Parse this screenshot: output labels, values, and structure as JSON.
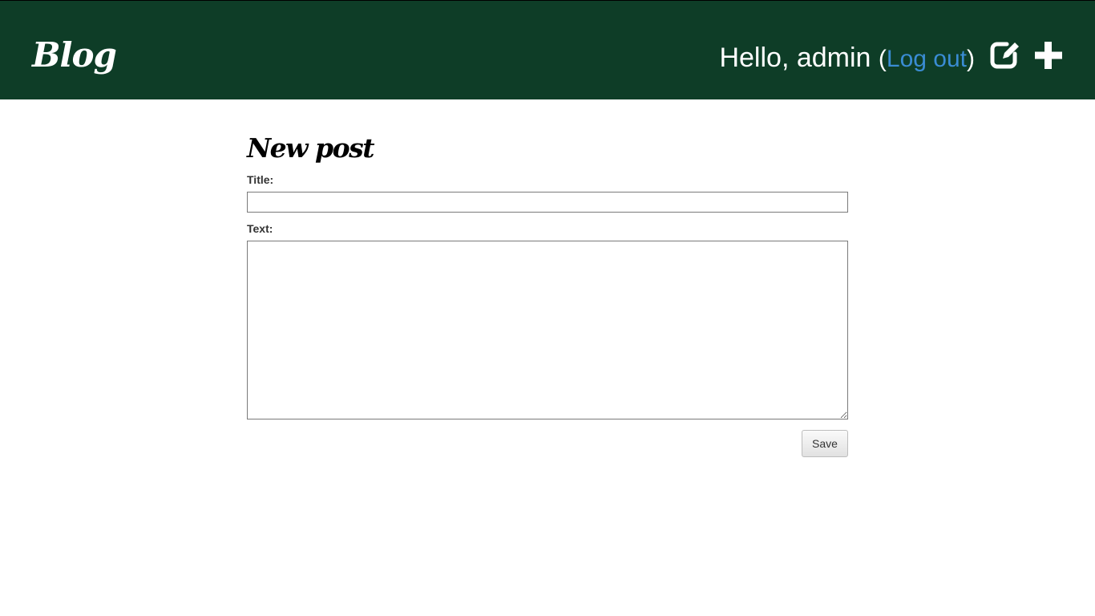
{
  "header": {
    "logo": "Blog",
    "greeting": "Hello, admin",
    "open_paren": "(",
    "logout_label": "Log out",
    "close_paren": ")",
    "icons": [
      "edit-icon",
      "plus-icon"
    ],
    "background_color": "#0e3d27",
    "link_color": "#3a8cd3"
  },
  "form": {
    "heading": "New post",
    "title_label": "Title:",
    "title_value": "",
    "text_label": "Text:",
    "text_value": "",
    "save_label": "Save"
  }
}
